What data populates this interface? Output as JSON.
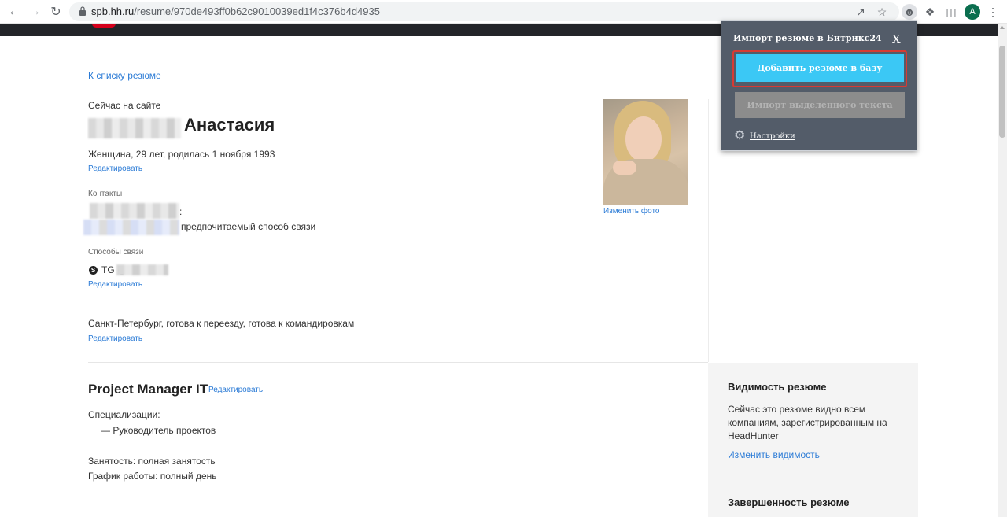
{
  "browser": {
    "url_host": "spb.hh.ru",
    "url_path": "/resume/970de493ff0b62c9010039ed1f4c376b4d4935",
    "avatar_letter": "A",
    "icons": [
      "back-arrow-icon",
      "forward-arrow-icon",
      "reload-icon",
      "lock-icon",
      "share-icon",
      "bookmark-star-icon",
      "profile-extension-icon",
      "puzzle-icon",
      "sidebar-icon",
      "menu-dots-icon"
    ]
  },
  "resume": {
    "back_link": "К списку резюме",
    "online_status": "Сейчас на сайте",
    "first_name": "Анастасия",
    "personal_line": "Женщина, 29 лет, родилась 1 ноября 1993",
    "edit_label": "Редактировать",
    "contacts_label": "Контакты",
    "contact_colon": ":",
    "preferred_contact": "предпочитаемый способ связи",
    "ways_label": "Способы связи",
    "tg_label": "TG @",
    "city_line": "Санкт-Петербург, готова к переезду, готова к командировкам",
    "change_photo": "Изменить фото",
    "position_title": "Project Manager IT",
    "specializations_label": "Специализации:",
    "specializations": [
      "— Руководитель проектов"
    ],
    "employment": "Занятость: полная занятость",
    "schedule": "График работы: полный день"
  },
  "sidebar": {
    "visibility_title": "Видимость резюме",
    "visibility_text": "Сейчас это резюме видно всем компаниям, зарегистрированным на HeadHunter",
    "visibility_link": "Изменить видимость",
    "completeness_title": "Завершенность резюме"
  },
  "bitrix_popup": {
    "title": "Импорт резюме в Битрикс24",
    "close_label": "X",
    "add_button": "Добавить резюме в базу",
    "import_button": "Импорт выделенного текста",
    "settings_link": "Настройки",
    "colors": {
      "background": "#535c69",
      "add_button": "#3bc8f5",
      "highlight": "#d83a33"
    }
  },
  "colors": {
    "link": "#2b7bd6",
    "header": "#232529",
    "brand_red": "#d6001c"
  }
}
